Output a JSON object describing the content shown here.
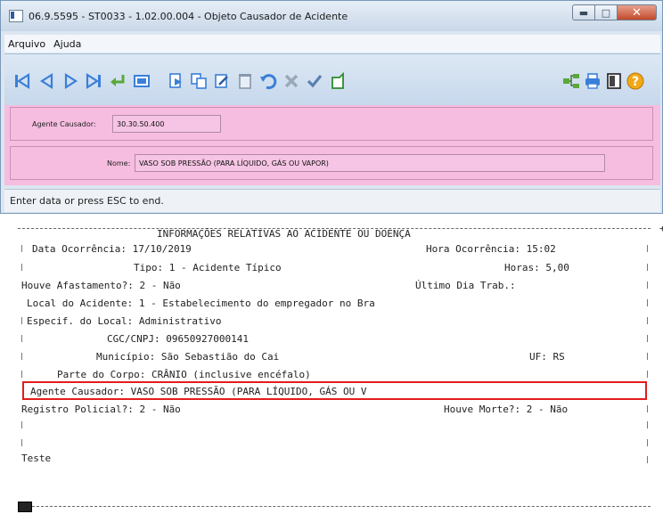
{
  "window": {
    "title": "06.9.5595 - ST0033 - 1.02.00.004 - Objeto Causador de Acidente",
    "icons": {
      "minimize": "minimize-icon",
      "maximize": "maximize-icon",
      "close": "close-icon"
    }
  },
  "menu": {
    "items": [
      "Arquivo",
      "Ajuda"
    ]
  },
  "toolbar": {
    "icons": [
      "first-record-icon",
      "previous-record-icon",
      "next-record-icon",
      "last-record-icon",
      "confirm-enter-icon",
      "view-icon",
      "new-record-icon",
      "copy-icon",
      "edit-icon",
      "delete-icon",
      "undo-icon",
      "cancel-icon",
      "save-icon",
      "clear-icon",
      "hierarchy-icon",
      "print-icon",
      "exit-icon",
      "help-icon"
    ],
    "colors": {
      "nav": "#3a7fd8",
      "green": "#5aa83a",
      "help": "#f0a818"
    }
  },
  "form": {
    "agente_label": "Agente Causador:",
    "agente_value": "30.30.50.400",
    "nome_label": "Nome:",
    "nome_value": "VASO SOB PRESSÃO (PARA LÍQUIDO, GÁS OU VAPOR)",
    "background": "#f6bde0"
  },
  "status": {
    "text": "Enter data or press ESC to end."
  },
  "report": {
    "title": "INFORMAÇÕES RELATIVAS AO ACIDENTE OU DOENÇA",
    "data_ocorrencia": "Data Ocorrência: 17/10/2019",
    "hora_ocorrencia": "Hora Ocorrência: 15:02",
    "tipo": "Tipo: 1 - Acidente Típico",
    "horas": "Horas: 5,00",
    "houve_afastamento": "Houve Afastamento?: 2 - Não",
    "ultimo_dia": "Último Dia Trab.:",
    "local_acidente": "Local do Acidente: 1 - Estabelecimento do empregador no Bra",
    "especif_local": "Especif. do Local: Administrativo",
    "cgc": "CGC/CNPJ: 09650927000141",
    "municipio": "Município: São Sebastião do Cai",
    "uf": "UF: RS",
    "parte_corpo": "Parte do Corpo: CRÂNIO (inclusive encéfalo)",
    "agente_causador": "Agente Causador: VASO SOB PRESSÃO (PARA LÍQUIDO, GÁS OU V",
    "registro_policial": "Registro Policial?: 2 - Não",
    "houve_morte": "Houve Morte?: 2 - Não",
    "observacao": "Teste",
    "highlight_color": "#e21d1d"
  }
}
